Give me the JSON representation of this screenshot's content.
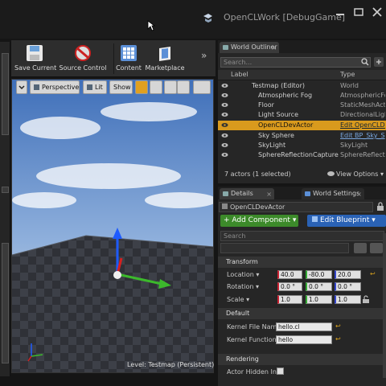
{
  "window": {
    "title": "OpenCLWork [DebugGame]"
  },
  "toolbar": {
    "save_current": "Save Current",
    "source_control": "Source Control",
    "content": "Content",
    "marketplace": "Marketplace",
    "more": "»"
  },
  "viewport": {
    "perspective": "Perspective",
    "lit": "Lit",
    "show": "Show",
    "level_label": "Level:",
    "level_name": "Testmap (Persistent)"
  },
  "outliner": {
    "tab_label": "World Outliner",
    "search_placeholder": "Search...",
    "col_label": "Label",
    "col_type": "Type",
    "rows": [
      {
        "label": "Testmap (Editor)",
        "type": "World"
      },
      {
        "label": "Atmospheric Fog",
        "type": "AtmosphericFog"
      },
      {
        "label": "Floor",
        "type": "StaticMeshActor"
      },
      {
        "label": "Light Source",
        "type": "DirectionalLight"
      },
      {
        "label": "OpenCLDevActor",
        "type": "Edit OpenCLDev"
      },
      {
        "label": "Sky Sphere",
        "type": "Edit BP_Sky_S"
      },
      {
        "label": "SkyLight",
        "type": "SkyLight"
      },
      {
        "label": "SphereReflectionCapture",
        "type": "SphereReflection"
      }
    ],
    "footer": "7 actors (1 selected)",
    "view_options": "View Options"
  },
  "details": {
    "tab_details": "Details",
    "tab_world_settings": "World Settings",
    "actor_name": "OpenCLDevActor",
    "add_component": "+ Add Component",
    "edit_blueprint": "Edit Blueprint",
    "search_placeholder": "Search",
    "transform_header": "Transform",
    "location_label": "Location",
    "location": [
      "40.0",
      "-80.0",
      "20.0"
    ],
    "rotation_label": "Rotation",
    "rotation": [
      "0.0 °",
      "0.0 °",
      "0.0 °"
    ],
    "scale_label": "Scale",
    "scale": [
      "1.0",
      "1.0",
      "1.0"
    ],
    "default_header": "Default",
    "kernel_file_label": "Kernel File Name",
    "kernel_file_value": "hello.cl",
    "kernel_func_label": "Kernel Function N",
    "kernel_func_value": "hello",
    "rendering_header": "Rendering",
    "actor_hidden_label": "Actor Hidden In G"
  },
  "colors": {
    "selected_row": "#d99a1d",
    "add_component": "#3c8a2a",
    "edit_blueprint": "#2a62b5"
  }
}
